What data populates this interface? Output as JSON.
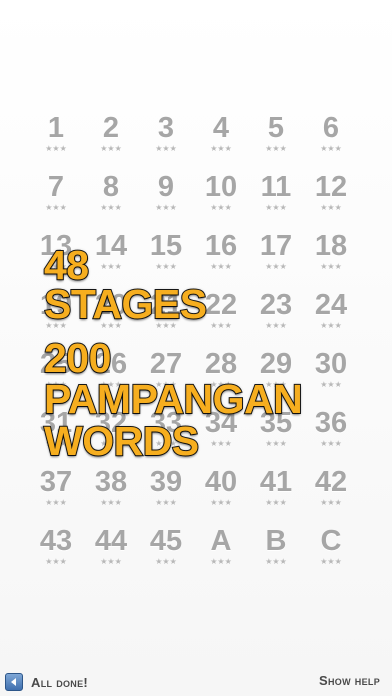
{
  "stages": [
    {
      "label": "1",
      "stars": "★★★"
    },
    {
      "label": "2",
      "stars": "★★★"
    },
    {
      "label": "3",
      "stars": "★★★"
    },
    {
      "label": "4",
      "stars": "★★★"
    },
    {
      "label": "5",
      "stars": "★★★"
    },
    {
      "label": "6",
      "stars": "★★★"
    },
    {
      "label": "7",
      "stars": "★★★"
    },
    {
      "label": "8",
      "stars": "★★★"
    },
    {
      "label": "9",
      "stars": "★★★"
    },
    {
      "label": "10",
      "stars": "★★★"
    },
    {
      "label": "11",
      "stars": "★★★"
    },
    {
      "label": "12",
      "stars": "★★★"
    },
    {
      "label": "13",
      "stars": "★★★"
    },
    {
      "label": "14",
      "stars": "★★★"
    },
    {
      "label": "15",
      "stars": "★★★"
    },
    {
      "label": "16",
      "stars": "★★★"
    },
    {
      "label": "17",
      "stars": "★★★"
    },
    {
      "label": "18",
      "stars": "★★★"
    },
    {
      "label": "19",
      "stars": "★★★"
    },
    {
      "label": "20",
      "stars": "★★★"
    },
    {
      "label": "21",
      "stars": "★★★"
    },
    {
      "label": "22",
      "stars": "★★★"
    },
    {
      "label": "23",
      "stars": "★★★"
    },
    {
      "label": "24",
      "stars": "★★★"
    },
    {
      "label": "25",
      "stars": "★★★"
    },
    {
      "label": "26",
      "stars": "★★★"
    },
    {
      "label": "27",
      "stars": "★★★"
    },
    {
      "label": "28",
      "stars": "★★★"
    },
    {
      "label": "29",
      "stars": "★★★"
    },
    {
      "label": "30",
      "stars": "★★★"
    },
    {
      "label": "31",
      "stars": "★★★"
    },
    {
      "label": "32",
      "stars": "★★★"
    },
    {
      "label": "33",
      "stars": "★★★"
    },
    {
      "label": "34",
      "stars": "★★★"
    },
    {
      "label": "35",
      "stars": "★★★"
    },
    {
      "label": "36",
      "stars": "★★★"
    },
    {
      "label": "37",
      "stars": "★★★"
    },
    {
      "label": "38",
      "stars": "★★★"
    },
    {
      "label": "39",
      "stars": "★★★"
    },
    {
      "label": "40",
      "stars": "★★★"
    },
    {
      "label": "41",
      "stars": "★★★"
    },
    {
      "label": "42",
      "stars": "★★★"
    },
    {
      "label": "43",
      "stars": "★★★"
    },
    {
      "label": "44",
      "stars": "★★★"
    },
    {
      "label": "45",
      "stars": "★★★"
    },
    {
      "label": "A",
      "stars": "★★★"
    },
    {
      "label": "B",
      "stars": "★★★"
    },
    {
      "label": "C",
      "stars": "★★★"
    }
  ],
  "promo": {
    "line1": "48",
    "line2": "STAGES",
    "line3": "200",
    "line4": "PAMPANGAN",
    "line5": "WORDS"
  },
  "footer": {
    "back_icon": "back-arrow-icon",
    "all_done_label": "All done!",
    "show_help_label": "Show help"
  },
  "colors": {
    "stage_number": "#a6a6a6",
    "promo_fill": "#f6ae1f",
    "promo_outline": "#1a1a1a",
    "back_button": "#3f6fae"
  }
}
